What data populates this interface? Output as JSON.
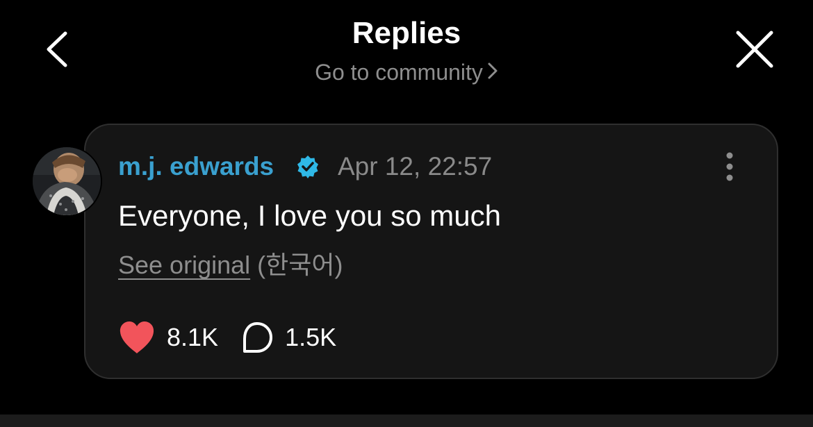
{
  "header": {
    "title": "Replies",
    "community_link": "Go to community",
    "back_icon": "chevron-left-icon",
    "close_icon": "close-icon"
  },
  "reply": {
    "username": "m.j. edwards",
    "verified": true,
    "timestamp": "Apr 12, 22:57",
    "text": "Everyone, I love you so much",
    "see_original": "See original",
    "original_language": "(한국어)",
    "likes": "8.1K",
    "comments": "1.5K",
    "liked": true
  },
  "colors": {
    "background": "#000000",
    "card": "#151515",
    "username": "#3aa0cf",
    "verified_badge": "#2fb8e6",
    "heart": "#f2545b",
    "muted_text": "#8e8e8e"
  }
}
